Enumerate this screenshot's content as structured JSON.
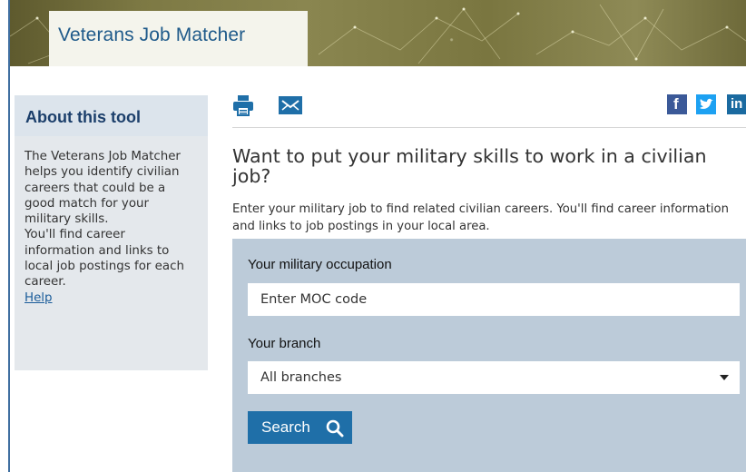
{
  "header": {
    "title": "Veterans Job Matcher"
  },
  "sidebar": {
    "heading": "About this tool",
    "paragraph1": "The Veterans Job Matcher helps you identify civilian careers that could be a good match for your military skills.",
    "paragraph2": "You'll find career information and links to local job postings for each career.",
    "help_link": "Help"
  },
  "toolbar": {
    "print_icon": "printer-icon",
    "email_icon": "envelope-icon",
    "share": [
      {
        "name": "facebook-icon",
        "glyph": "f",
        "color": "#3b5998"
      },
      {
        "name": "twitter-icon",
        "glyph": "",
        "color": "#1da1f2"
      },
      {
        "name": "linkedin-icon",
        "glyph": "in",
        "color": "#1a6aa0"
      }
    ]
  },
  "main": {
    "headline": "Want to put your military skills to work in a civilian job?",
    "intro": "Enter your military job to find related civilian careers. You'll find career information and links to job postings in your local area."
  },
  "form": {
    "occupation_label": "Your military occupation",
    "occupation_placeholder": "Enter MOC code",
    "occupation_value": "",
    "branch_label": "Your branch",
    "branch_selected": "All branches",
    "search_label": "Search",
    "search_icon": "magnifier-icon"
  },
  "colors": {
    "accent": "#1f6fa8",
    "heading": "#1c3f6b",
    "panel": "#bccbd9",
    "sidebar": "#e4e8ec"
  }
}
